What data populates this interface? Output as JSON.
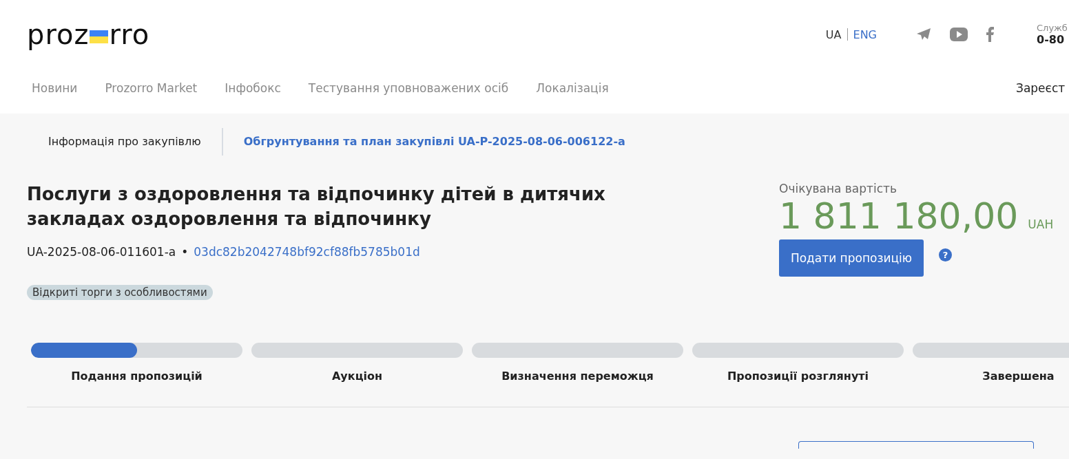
{
  "header": {
    "logo": {
      "left": "proz",
      "right": "rro"
    },
    "languages": [
      {
        "label": "UA",
        "selected": true
      },
      {
        "label": "ENG",
        "selected": false
      }
    ],
    "support": {
      "label": "Служб",
      "phone": "0-80"
    }
  },
  "nav": {
    "items": [
      "Новини",
      "Prozorro Market",
      "Інфобокс",
      "Тестування уповноважених осіб",
      "Локалізація"
    ],
    "register": "Зареєст"
  },
  "tabs": [
    {
      "label": "Інформація про закупівлю",
      "selected": true
    },
    {
      "label": "Обгрунтування та план закупівлі UA-P-2025-08-06-006122-a",
      "selected": false
    }
  ],
  "tender": {
    "title": "Послуги з оздоровлення та відпочинку дітей в дитячих закладах оздоровлення та відпочинку",
    "id": "UA-2025-08-06-011601-a",
    "separator": "•",
    "hash": "03dc82b2042748bf92cf88fb5785b01d",
    "badge": "Відкриті торги з особливостями"
  },
  "value": {
    "label": "Очікувана вартість",
    "amount": "1 811 180,00",
    "currency": "UAH",
    "button": "Подати пропозицію",
    "help": "?"
  },
  "stages": [
    {
      "label": "Подання пропозицій",
      "level": 0.5
    },
    {
      "label": "Аукціон"
    },
    {
      "label": "Визначення переможця"
    },
    {
      "label": "Пропозиції розглянуті"
    },
    {
      "label": "Завершена"
    }
  ]
}
